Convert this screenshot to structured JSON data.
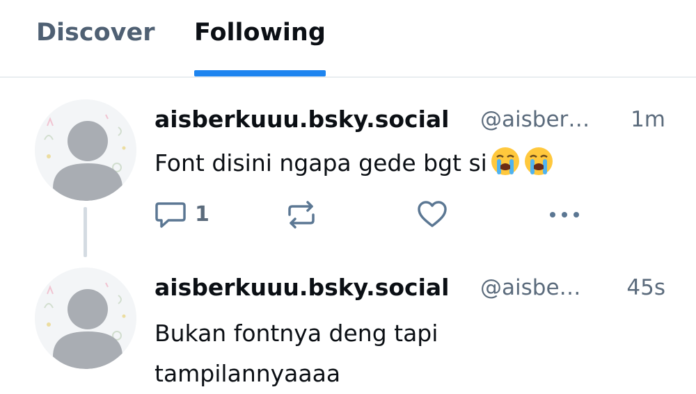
{
  "tabs": [
    {
      "label": "Discover",
      "active": false
    },
    {
      "label": "Following",
      "active": true
    }
  ],
  "accent_color": "#1d84ef",
  "posts": [
    {
      "author": "aisberkuuu.bsky.social",
      "handle": "@aisber…",
      "time": "1m",
      "text": "Font disini ngapa gede bgt si",
      "emojis": [
        "loudly-crying-face-icon",
        "loudly-crying-face-icon"
      ],
      "reply_count": "1"
    },
    {
      "author": "aisberkuuu.bsky.social",
      "handle": "@aisbe…",
      "time": "45s",
      "text_lines": [
        "Bukan fontnya deng tapi",
        "tampilannyaaaa"
      ]
    }
  ]
}
